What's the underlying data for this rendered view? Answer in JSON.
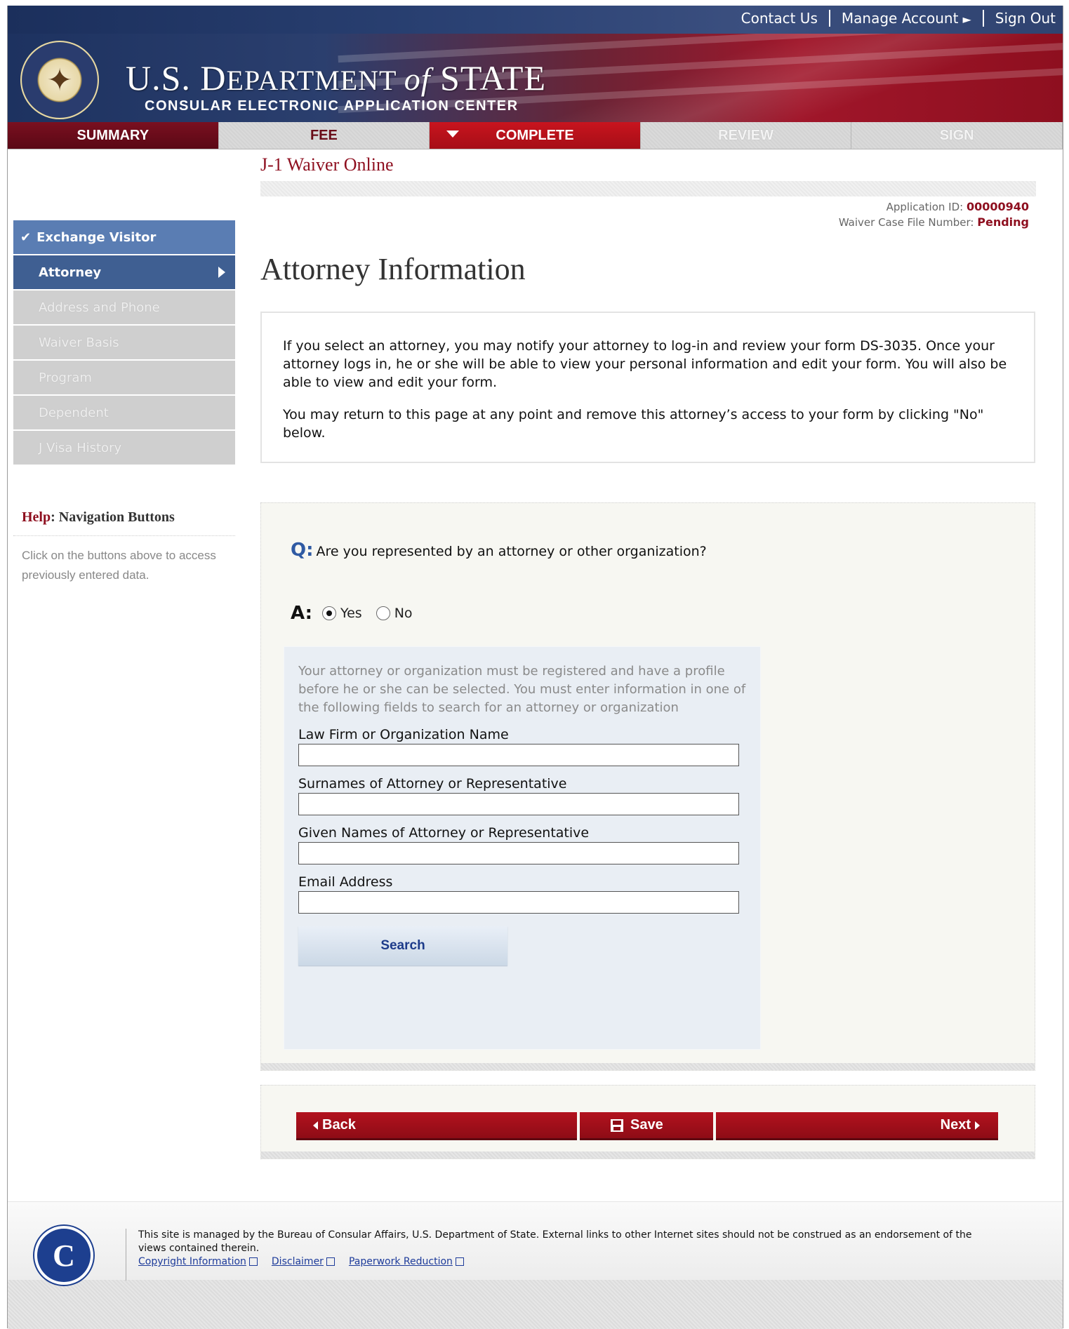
{
  "header": {
    "links": [
      "Contact Us",
      "Manage Account",
      "Sign Out"
    ],
    "dept_title_a": "U.S. D",
    "dept_title_b": "EPARTMENT ",
    "dept_title_of": "of",
    "dept_title_c": " STATE",
    "dept_subtitle": "CONSULAR ELECTRONIC APPLICATION CENTER"
  },
  "steps": [
    {
      "label": "SUMMARY",
      "state": "visited"
    },
    {
      "label": "FEE",
      "state": "visited"
    },
    {
      "label": "COMPLETE",
      "state": "current"
    },
    {
      "label": "REVIEW",
      "state": "disabled"
    },
    {
      "label": "SIGN",
      "state": "disabled"
    }
  ],
  "sidebar": {
    "items": [
      {
        "label": "Exchange Visitor",
        "state": "done"
      },
      {
        "label": "Attorney",
        "state": "active"
      },
      {
        "label": "Address and Phone",
        "state": "disabled"
      },
      {
        "label": "Waiver Basis",
        "state": "disabled"
      },
      {
        "label": "Program",
        "state": "disabled"
      },
      {
        "label": "Dependent",
        "state": "disabled"
      },
      {
        "label": "J Visa History",
        "state": "disabled"
      }
    ],
    "help_prefix": "Help",
    "help_title": ": Navigation Buttons",
    "help_text": "Click on the buttons above to access previously entered data."
  },
  "main": {
    "app_name": "J-1 Waiver Online",
    "application_id_label": "Application ID: ",
    "application_id": "00000940",
    "case_file_label": "Waiver Case File Number: ",
    "case_file_value": "Pending",
    "page_title": "Attorney Information",
    "info_p1": "If you select an attorney, you may notify your attorney to log-in and review your form DS-3035. Once your attorney logs in, he or she will be able to view your personal information and edit your form. You will also be able to view and edit your form.",
    "info_p2": "You may return to this page at any point and remove this attorney’s access to your form by clicking \"No\" below.",
    "question_prefix": "Q:",
    "question": "Are you represented by an attorney or other organization?",
    "answer_prefix": "A:",
    "option_yes": "Yes",
    "option_no": "No",
    "selected": "Yes",
    "search_note": "Your attorney or organization must be registered and have a profile before he or she can be selected. You must enter information in one of the following fields to search for an attorney or organization",
    "fields": [
      {
        "label": "Law Firm or Organization Name",
        "value": ""
      },
      {
        "label": "Surnames of Attorney or Representative",
        "value": ""
      },
      {
        "label": "Given Names of Attorney or Representative",
        "value": ""
      },
      {
        "label": "Email Address",
        "value": ""
      }
    ],
    "search_button": "Search"
  },
  "nav_buttons": {
    "back": "Back",
    "save": "Save",
    "next": "Next"
  },
  "footer": {
    "text": "This site is managed by the Bureau of Consular Affairs, U.S. Department of State. External links to other Internet sites should not be construed as an endorsement of the views contained therein.",
    "links": [
      "Copyright Information",
      "Disclaimer",
      "Paperwork Reduction"
    ],
    "logo_letter": "C"
  },
  "colors": {
    "brand_red": "#8e0f1f",
    "brand_blue": "#2b4274",
    "nav_active": "#3f5f92"
  }
}
